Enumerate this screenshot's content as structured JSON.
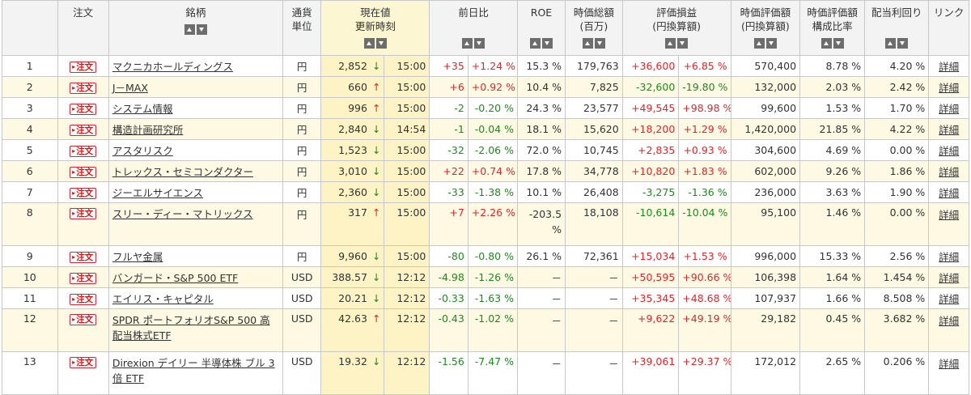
{
  "headers": {
    "no": "",
    "order": "注文",
    "name": "銘柄",
    "currency_l1": "通貨",
    "currency_l2": "単位",
    "price_l1": "現在値",
    "price_l2": "更新時刻",
    "change": "前日比",
    "roe": "ROE",
    "mcap_l1": "時価総額",
    "mcap_l2": "(百万)",
    "pl_l1": "評価損益",
    "pl_l2": "(円換算額)",
    "mv_l1": "時価評価額",
    "mv_l2": "(円換算額)",
    "ratio_l1": "時価評価額",
    "ratio_l2": "構成比率",
    "yield": "配当利回り",
    "link": "リンク"
  },
  "order_label": "注文",
  "detail_label": "詳細",
  "rows": [
    {
      "no": "1",
      "name": "マクニカホールディングス",
      "cur": "円",
      "price": "2,852",
      "dir": "down",
      "time": "15:00",
      "chg": "+35",
      "chgp": "+1.24 %",
      "roe": "15.3 %",
      "mcap": "179,763",
      "pl": "+36,600",
      "plp": "+6.85 %",
      "mv": "570,400",
      "ratio": "8.78 %",
      "yield": "4.20 %"
    },
    {
      "no": "2",
      "name": "J－MAX",
      "cur": "円",
      "price": "660",
      "dir": "up",
      "time": "15:00",
      "chg": "+6",
      "chgp": "+0.92 %",
      "roe": "10.4 %",
      "mcap": "7,825",
      "pl": "-32,600",
      "plp": "-19.80 %",
      "mv": "132,000",
      "ratio": "2.03 %",
      "yield": "2.42 %"
    },
    {
      "no": "3",
      "name": "システム情報",
      "cur": "円",
      "price": "996",
      "dir": "up",
      "time": "15:00",
      "chg": "-2",
      "chgp": "-0.20 %",
      "roe": "24.3 %",
      "mcap": "23,577",
      "pl": "+49,545",
      "plp": "+98.98 %",
      "mv": "99,600",
      "ratio": "1.53 %",
      "yield": "1.70 %"
    },
    {
      "no": "4",
      "name": "構造計画研究所",
      "cur": "円",
      "price": "2,840",
      "dir": "down",
      "time": "14:54",
      "chg": "-1",
      "chgp": "-0.04 %",
      "roe": "18.1 %",
      "mcap": "15,620",
      "pl": "+18,200",
      "plp": "+1.29 %",
      "mv": "1,420,000",
      "ratio": "21.85 %",
      "yield": "4.22 %"
    },
    {
      "no": "5",
      "name": "アスタリスク",
      "cur": "円",
      "price": "1,523",
      "dir": "down",
      "time": "15:00",
      "chg": "-32",
      "chgp": "-2.06 %",
      "roe": "72.0 %",
      "mcap": "10,745",
      "pl": "+2,835",
      "plp": "+0.93 %",
      "mv": "304,600",
      "ratio": "4.69 %",
      "yield": "0.00 %"
    },
    {
      "no": "6",
      "name": "トレックス・セミコンダクター",
      "cur": "円",
      "price": "3,010",
      "dir": "down",
      "time": "15:00",
      "chg": "+22",
      "chgp": "+0.74 %",
      "roe": "17.8 %",
      "mcap": "34,778",
      "pl": "+10,820",
      "plp": "+1.83 %",
      "mv": "602,000",
      "ratio": "9.26 %",
      "yield": "1.86 %"
    },
    {
      "no": "7",
      "name": "ジーエルサイエンス",
      "cur": "円",
      "price": "2,360",
      "dir": "down",
      "time": "15:00",
      "chg": "-33",
      "chgp": "-1.38 %",
      "roe": "10.1 %",
      "mcap": "26,408",
      "pl": "-3,275",
      "plp": "-1.36 %",
      "mv": "236,000",
      "ratio": "3.63 %",
      "yield": "1.90 %"
    },
    {
      "no": "8",
      "name": "スリー・ディー・マトリックス",
      "cur": "円",
      "price": "317",
      "dir": "up",
      "time": "15:00",
      "chg": "+7",
      "chgp": "+2.26 %",
      "roe": "-203.5 %",
      "mcap": "18,108",
      "pl": "-10,614",
      "plp": "-10.04 %",
      "mv": "95,100",
      "ratio": "1.46 %",
      "yield": "0.00 %",
      "tall": true
    },
    {
      "no": "9",
      "name": "フルヤ金属",
      "cur": "円",
      "price": "9,960",
      "dir": "down",
      "time": "15:00",
      "chg": "-80",
      "chgp": "-0.80 %",
      "roe": "26.1 %",
      "mcap": "72,361",
      "pl": "+15,034",
      "plp": "+1.53 %",
      "mv": "996,000",
      "ratio": "15.33 %",
      "yield": "2.56 %"
    },
    {
      "no": "10",
      "name": "バンガード・S&P 500 ETF",
      "cur": "USD",
      "price": "388.57",
      "dir": "down",
      "time": "12:12",
      "chg": "-4.98",
      "chgp": "-1.26 %",
      "roe": "－",
      "mcap": "－",
      "pl": "+50,595",
      "plp": "+90.66 %",
      "mv": "106,398",
      "ratio": "1.64 %",
      "yield": "1.454 %"
    },
    {
      "no": "11",
      "name": "エイリス・キャピタル",
      "cur": "USD",
      "price": "20.21",
      "dir": "down",
      "time": "12:12",
      "chg": "-0.33",
      "chgp": "-1.63 %",
      "roe": "－",
      "mcap": "－",
      "pl": "+35,345",
      "plp": "+48.68 %",
      "mv": "107,937",
      "ratio": "1.66 %",
      "yield": "8.508 %"
    },
    {
      "no": "12",
      "name": "SPDR ポートフォリオS&P 500 高配当株式ETF",
      "cur": "USD",
      "price": "42.63",
      "dir": "up",
      "time": "12:12",
      "chg": "-0.43",
      "chgp": "-1.02 %",
      "roe": "－",
      "mcap": "－",
      "pl": "+9,622",
      "plp": "+49.19 %",
      "mv": "29,182",
      "ratio": "0.45 %",
      "yield": "3.682 %",
      "tall": true
    },
    {
      "no": "13",
      "name": "Direxion デイリー 半導体株 ブル 3倍 ETF",
      "cur": "USD",
      "price": "19.32",
      "dir": "down",
      "time": "12:12",
      "chg": "-1.56",
      "chgp": "-7.47 %",
      "roe": "－",
      "mcap": "－",
      "pl": "+39,061",
      "plp": "+29.37 %",
      "mv": "172,012",
      "ratio": "2.65 %",
      "yield": "0.206 %",
      "tall": true
    }
  ],
  "colors": {
    "positive": "#e4242a",
    "negative": "#1f8a1f",
    "price_bg": "#fdf3c4",
    "alt_row": "#fdf9e3"
  },
  "icons": {
    "sort_up": "triangle-up-icon",
    "sort_down": "triangle-down-icon",
    "price_up": "arrow-up-icon",
    "price_down": "arrow-down-icon"
  }
}
